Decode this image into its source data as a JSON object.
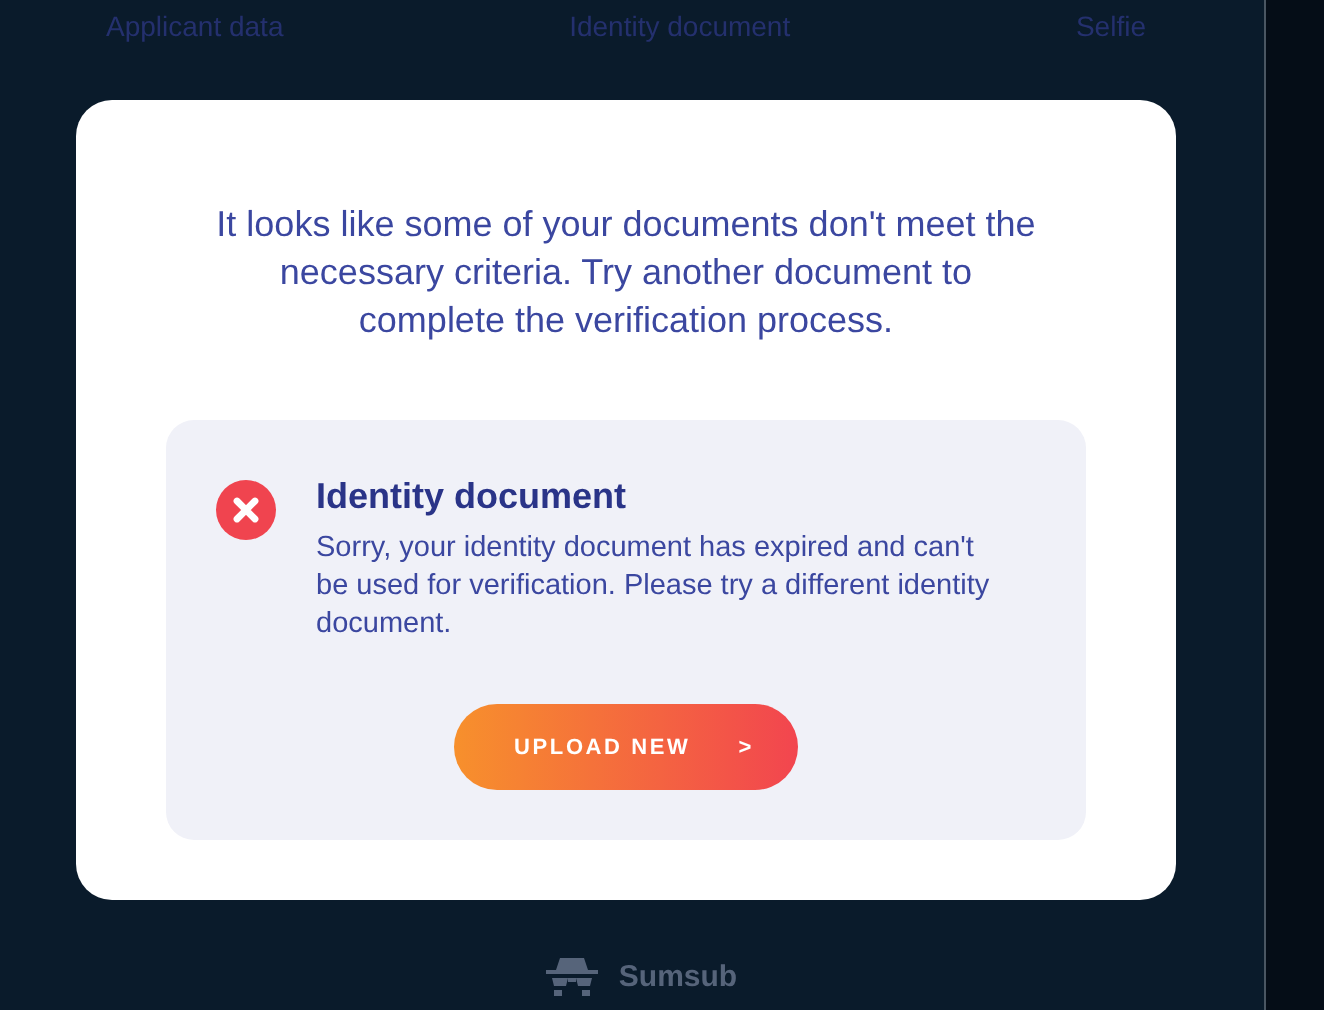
{
  "steps": [
    {
      "label": "Applicant data"
    },
    {
      "label": "Identity document"
    },
    {
      "label": "Selfie"
    }
  ],
  "dialog": {
    "message": "It looks like some of your documents don't meet the necessary criteria. Try another document to complete the verification process.",
    "issue": {
      "kind": "error",
      "title": "Identity document",
      "description": "Sorry, your identity document has expired and can't be used for verification. Please try a different identity document."
    },
    "button": {
      "label": "UPLOAD NEW",
      "arrow": ">"
    }
  },
  "footer": {
    "brand": "Sumsub"
  }
}
